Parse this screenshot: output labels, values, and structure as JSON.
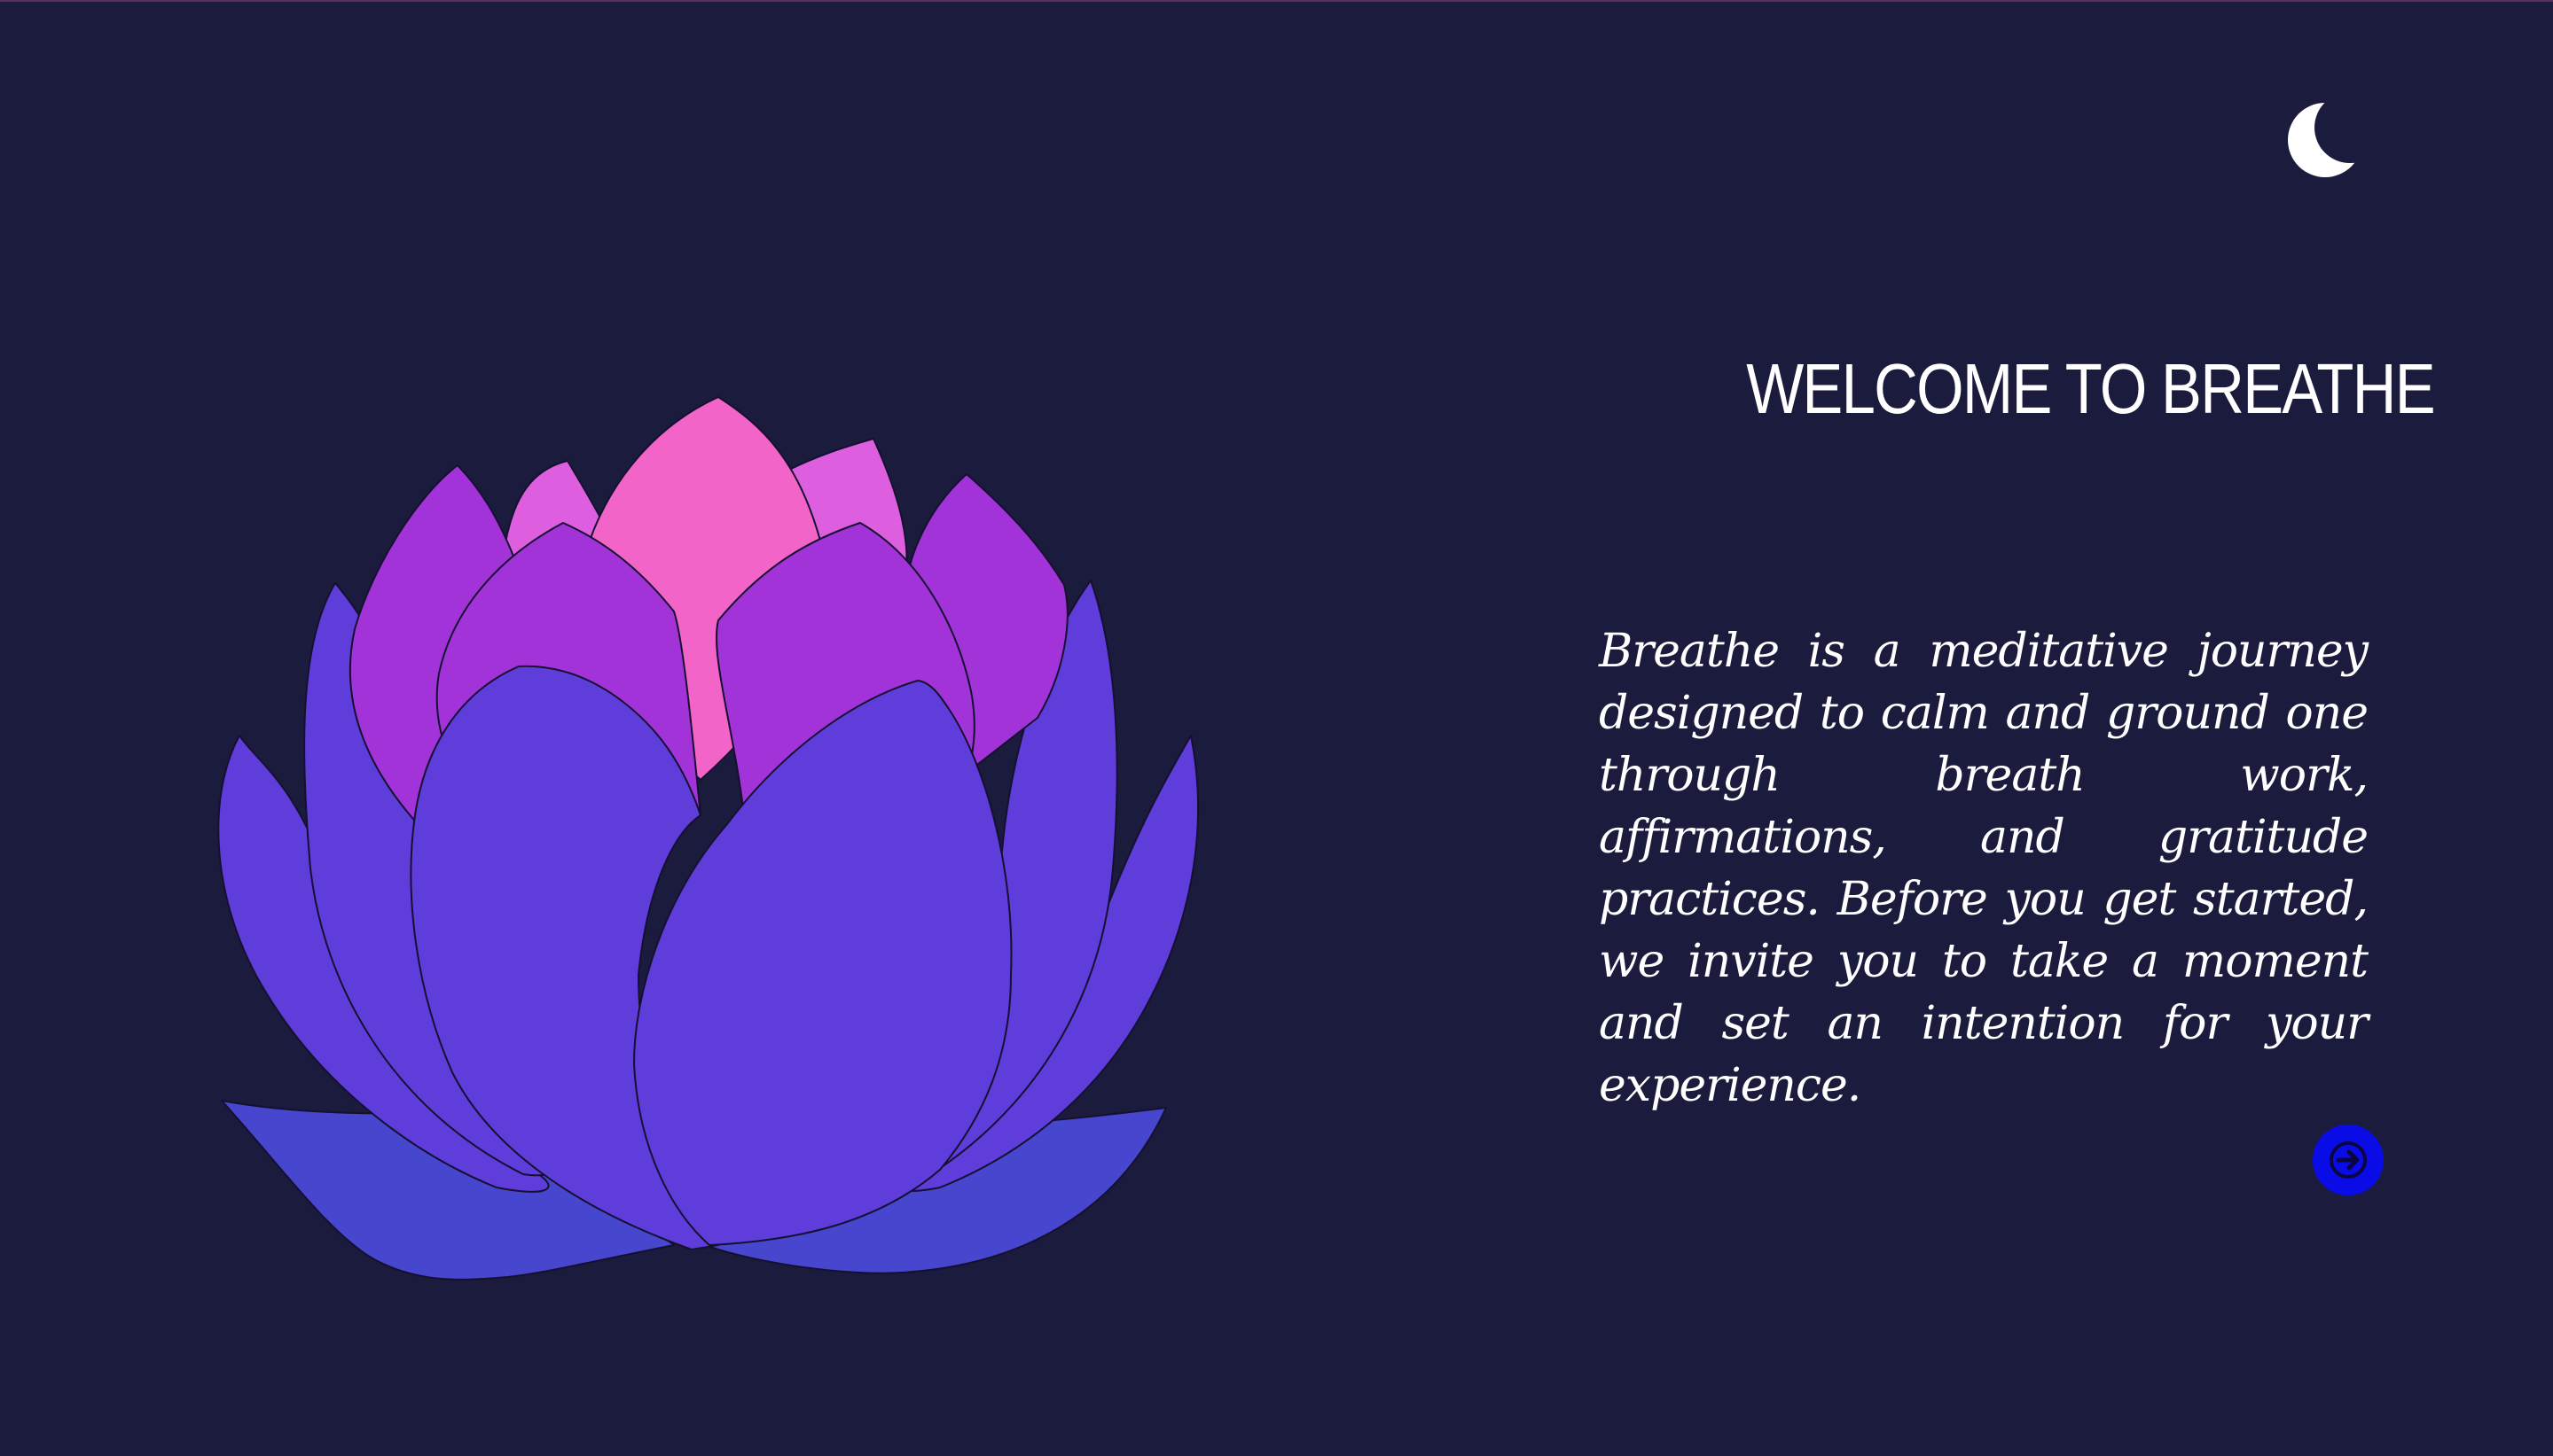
{
  "theme": {
    "background": "#1b1b3e",
    "accent_button": "#0a0ce8",
    "text": "#ffffff"
  },
  "header": {
    "theme_toggle_icon": "crescent-moon-icon"
  },
  "illustration": {
    "name": "lotus-flower",
    "colors": {
      "pink": "#f264c7",
      "magenta": "#dd5fe0",
      "purple": "#a233d8",
      "violet": "#5f3ddb",
      "water_leaf": "#4646cf"
    }
  },
  "welcome": {
    "title": "WELCOME TO BREATHE",
    "description": "Breathe is a meditative journey designed to calm and ground one through breath work, affirmations, and gratitude practices. Before you get started, we invite you to take a moment and set an intention for your experience."
  },
  "navigation": {
    "next_icon": "arrow-right-circle-icon"
  }
}
